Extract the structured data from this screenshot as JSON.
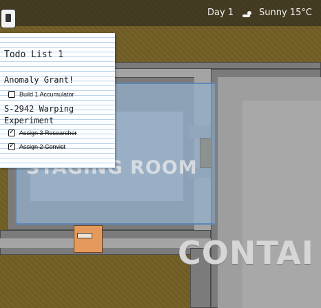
{
  "hud": {
    "day": "Day 1",
    "weather": "Sunny 15°C",
    "weather_icon": "cloud-sun-icon",
    "todo_toggle_icon": "clipboard-icon"
  },
  "todo": {
    "title": "Todo List 1",
    "sections": [
      {
        "heading": "Anomaly Grant!",
        "items": [
          {
            "label": "Build 1 Accumulator",
            "done": false
          }
        ]
      },
      {
        "heading": "S-2942 Warping Experiment",
        "items": [
          {
            "label": "Assign 3 Researcher",
            "done": true
          },
          {
            "label": "Assign 2 Convict",
            "done": true
          }
        ]
      }
    ]
  },
  "map": {
    "staging_room_label": "STAGING ROOM",
    "containment_label": "CONTAI"
  }
}
